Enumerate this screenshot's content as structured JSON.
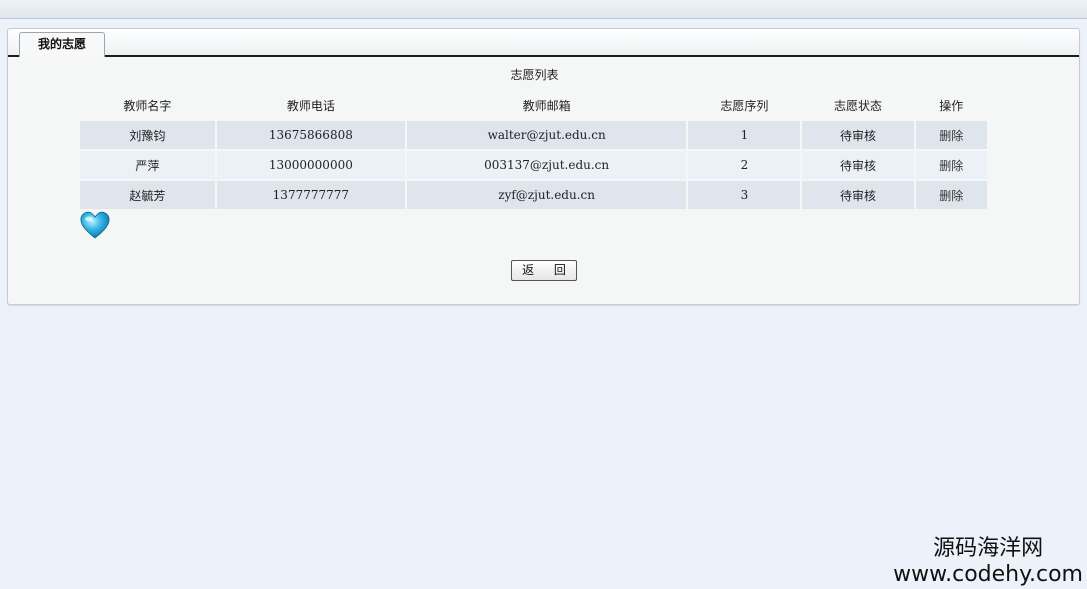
{
  "tab": {
    "label": "我的志愿"
  },
  "list_title": "志愿列表",
  "table": {
    "headers": [
      "教师名字",
      "教师电话",
      "教师邮箱",
      "志愿序列",
      "志愿状态",
      "操作"
    ],
    "rows": [
      {
        "name": "刘豫钧",
        "phone": "13675866808",
        "email": "walter@zjut.edu.cn",
        "order": "1",
        "status": "待审核",
        "action": "删除"
      },
      {
        "name": "严萍",
        "phone": "13000000000",
        "email": "003137@zjut.edu.cn",
        "order": "2",
        "status": "待审核",
        "action": "删除"
      },
      {
        "name": "赵毓芳",
        "phone": "1377777777",
        "email": "zyf@zjut.edu.cn",
        "order": "3",
        "status": "待审核",
        "action": "删除"
      }
    ]
  },
  "buttons": {
    "back": "返 回"
  },
  "watermark": {
    "line1": "源码海洋网",
    "line2": "www.codehy.com"
  },
  "icons": {
    "heart": "heart-icon"
  },
  "colors": {
    "background": "#edf2fa",
    "row_odd": "#dfe5ed",
    "row_even": "#ecf1f8",
    "tab_border": "#1d1d1d"
  }
}
